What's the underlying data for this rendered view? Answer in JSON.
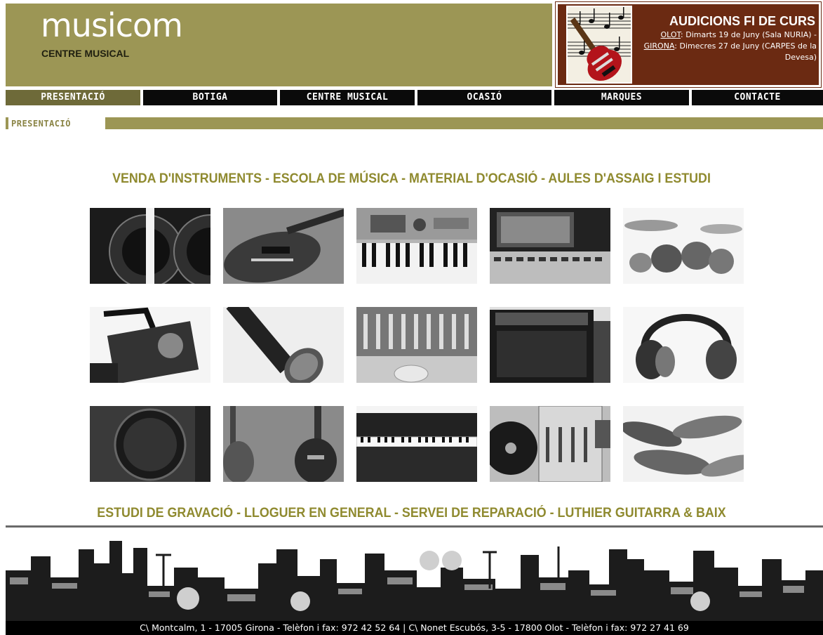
{
  "brand": {
    "name": "musicom",
    "subtitle": "CENTRE MUSICAL"
  },
  "promo": {
    "title": "AUDICIONS FI DE CURS",
    "olot_link": "OLOT",
    "olot_text": ": Dimarts 19 de Juny (Sala NURIA) - ",
    "girona_link": "GIRONA",
    "girona_text": ": Dimecres 27 de Juny (CARPES de la Devesa)"
  },
  "nav": {
    "items": [
      {
        "label": "PRESENTACIÓ",
        "active": true
      },
      {
        "label": "BOTIGA",
        "active": false
      },
      {
        "label": "CENTRE MUSICAL",
        "active": false
      },
      {
        "label": "OCASIÓ",
        "active": false
      },
      {
        "label": "MARQUES",
        "active": false
      },
      {
        "label": "CONTACTE",
        "active": false
      }
    ]
  },
  "section": {
    "title": "PRESENTACIÓ"
  },
  "taglines": {
    "top": "VENDA D'INSTRUMENTS - ESCOLA DE MÚSICA - MATERIAL D'OCASIÓ -  AULES D'ASSAIG I ESTUDI",
    "bottom": "ESTUDI DE GRAVACIÓ - LLOGUER EN GENERAL - SERVEI DE REPARACIÓ - LUTHIER GUITARRA & BAIX"
  },
  "gallery": {
    "items": [
      "speaker-monitors-photo",
      "electric-guitar-photo",
      "synth-keyboard-photo",
      "mixing-console-photo",
      "drum-kit-photo",
      "stage-light-photo",
      "microphone-photo",
      "cd-mixer-photo",
      "guitar-amplifier-photo",
      "headphones-photo",
      "pa-speaker-photo",
      "bass-guitars-photo",
      "digital-piano-photo",
      "dj-turntable-mixer-photo",
      "cymbals-photo"
    ]
  },
  "footer": {
    "text": "C\\ Montcalm, 1 - 17005 Girona - Telèfon i fax: 972 42 52 64   |   C\\ Nonet Escubós, 3-5 - 17800 Olot - Telèfon i fax: 972 27 41 69"
  },
  "colors": {
    "olive": "#9c9655",
    "olive_dark": "#6e6a39",
    "promo_bg": "#6b2a12",
    "heading": "#8f8a2f"
  }
}
